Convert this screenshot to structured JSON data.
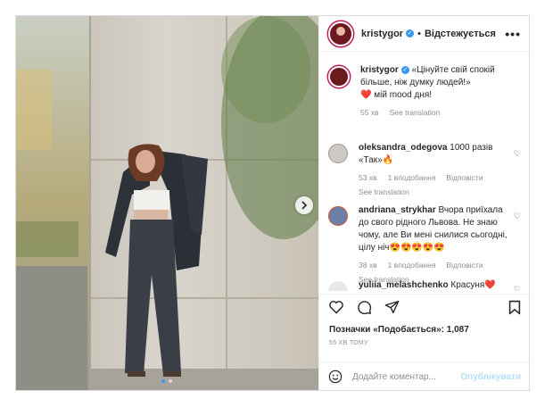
{
  "header": {
    "username": "kristygor",
    "separator": "•",
    "follow_label": "Відстежується",
    "more_icon": "more-horizontal-icon"
  },
  "caption": {
    "username": "kristygor",
    "text_line1": "«Цінуйте свій спокій більше, ніж думку людей!»",
    "text_line2": "❤️ мій mood дня!",
    "time": "55 хв",
    "see_translation": "See translation"
  },
  "comments": [
    {
      "username": "oleksandra_odegova",
      "text": "1000 разів «Так»🔥",
      "time": "53 хв",
      "likes": "1 вподобання",
      "reply": "Відповісти",
      "see_translation": "See translation"
    },
    {
      "username": "andriana_strykhar",
      "text": "Вчора приїхала до свого рідного Львова. Не знаю чому, але Ви мені снилися сьогодні, цілу ніч😍😍😍😍😍",
      "time": "38 хв",
      "likes": "1 вподобання",
      "reply": "Відповісти",
      "see_translation": "See translation"
    },
    {
      "username": "yuliia_melashchenko",
      "text": "Красуня❤️"
    }
  ],
  "likes_text": "Позначки «Подобається»: 1,087",
  "time_ago": "55 ХВ ТОМУ",
  "add_comment_placeholder": "Додайте коментар...",
  "publish_label": "Опублікувати",
  "carousel": {
    "current": 1,
    "total": 2
  }
}
